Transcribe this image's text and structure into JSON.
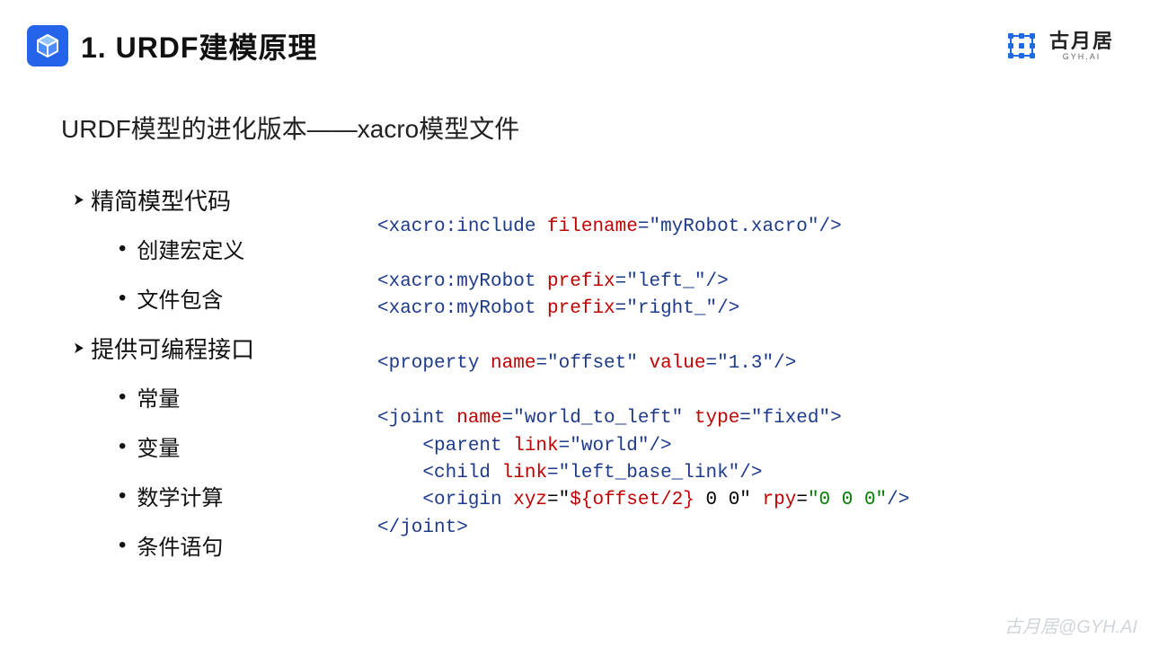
{
  "header": {
    "title": "1. URDF建模原理",
    "brand_cn": "古月居",
    "brand_en": "GYH.AI"
  },
  "subtitle": "URDF模型的进化版本——xacro模型文件",
  "outline": {
    "g1": "精简模型代码",
    "g1_items": [
      "创建宏定义",
      "文件包含"
    ],
    "g2": "提供可编程接口",
    "g2_items": [
      "常量",
      "变量",
      "数学计算",
      "条件语句"
    ]
  },
  "code": {
    "l1_a": "<xacro:include",
    "l1_b": " filename",
    "l1_c": "=\"myRobot.xacro\"/>",
    "l3_a": "<xacro:myRobot",
    "l3_b": " prefix",
    "l3_c": "=\"left_\"/>",
    "l4_a": "<xacro:myRobot",
    "l4_b": " prefix",
    "l4_c": "=\"right_\"/>",
    "l6_a": "<property",
    "l6_b": " name",
    "l6_c": "=\"offset\"",
    "l6_d": " value",
    "l6_e": "=\"1.3\"/>",
    "l8_a": "<joint",
    "l8_b": " name",
    "l8_c": "=\"world_to_left\"",
    "l8_d": " type",
    "l8_e": "=\"fixed\">",
    "l9_a": "    <parent",
    "l9_b": " link",
    "l9_c": "=\"world\"/>",
    "l10_a": "    <child",
    "l10_b": " link",
    "l10_c": "=\"left_base_link\"/>",
    "l11_a": "    <origin",
    "l11_b": " xyz",
    "l11_c": "=\"",
    "l11_d": "${offset/2}",
    "l11_e": " 0 0\"",
    "l11_f": " rpy",
    "l11_g": "=",
    "l11_h": "\"0 0 0\"",
    "l11_i": "/>",
    "l12_a": "</joint>"
  },
  "watermark": "古月居@GYH.AI"
}
